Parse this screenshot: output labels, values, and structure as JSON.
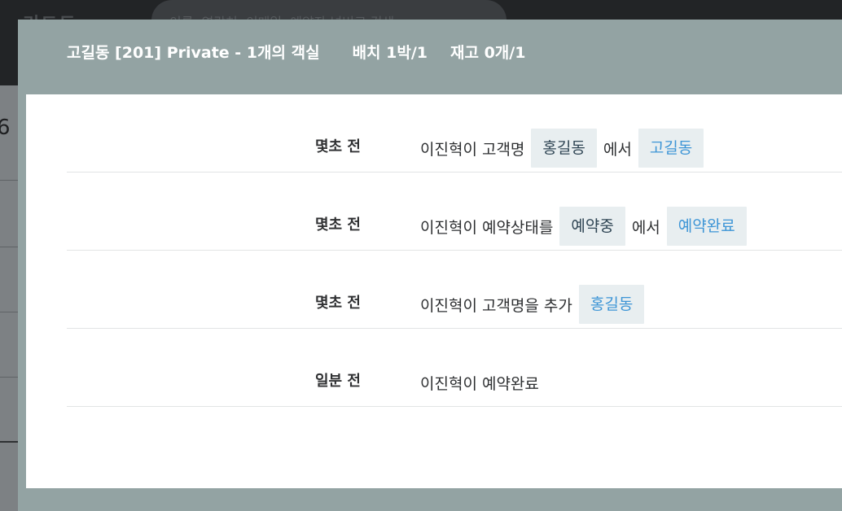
{
  "background": {
    "logo": "리드트",
    "search_placeholder": "이름, 연락처, 이메일, 예약자 넘버로 검색",
    "left_glyph": "6"
  },
  "modal": {
    "title": "고길동 [201] Private - 1개의 객실",
    "placement": "배치 1박/1",
    "stock": "재고 0개/1"
  },
  "history": [
    {
      "time": "몇초 전",
      "prefix": "이진혁이 고객명",
      "old": "홍길동",
      "middle": "에서",
      "new": "고길동"
    },
    {
      "time": "몇초 전",
      "prefix": "이진혁이 예약상태를",
      "old": "예약중",
      "middle": "에서",
      "new": "예약완료"
    },
    {
      "time": "몇초 전",
      "prefix": "이진혁이 고객명을 추가",
      "new": "홍길동"
    },
    {
      "time": "일분 전",
      "prefix": "이진혁이 예약완료"
    }
  ],
  "colors": {
    "header_bg": "#93a3a3",
    "chip_bg": "#e8eef0",
    "new_value": "#3d95d6",
    "old_value": "#2f4554"
  }
}
